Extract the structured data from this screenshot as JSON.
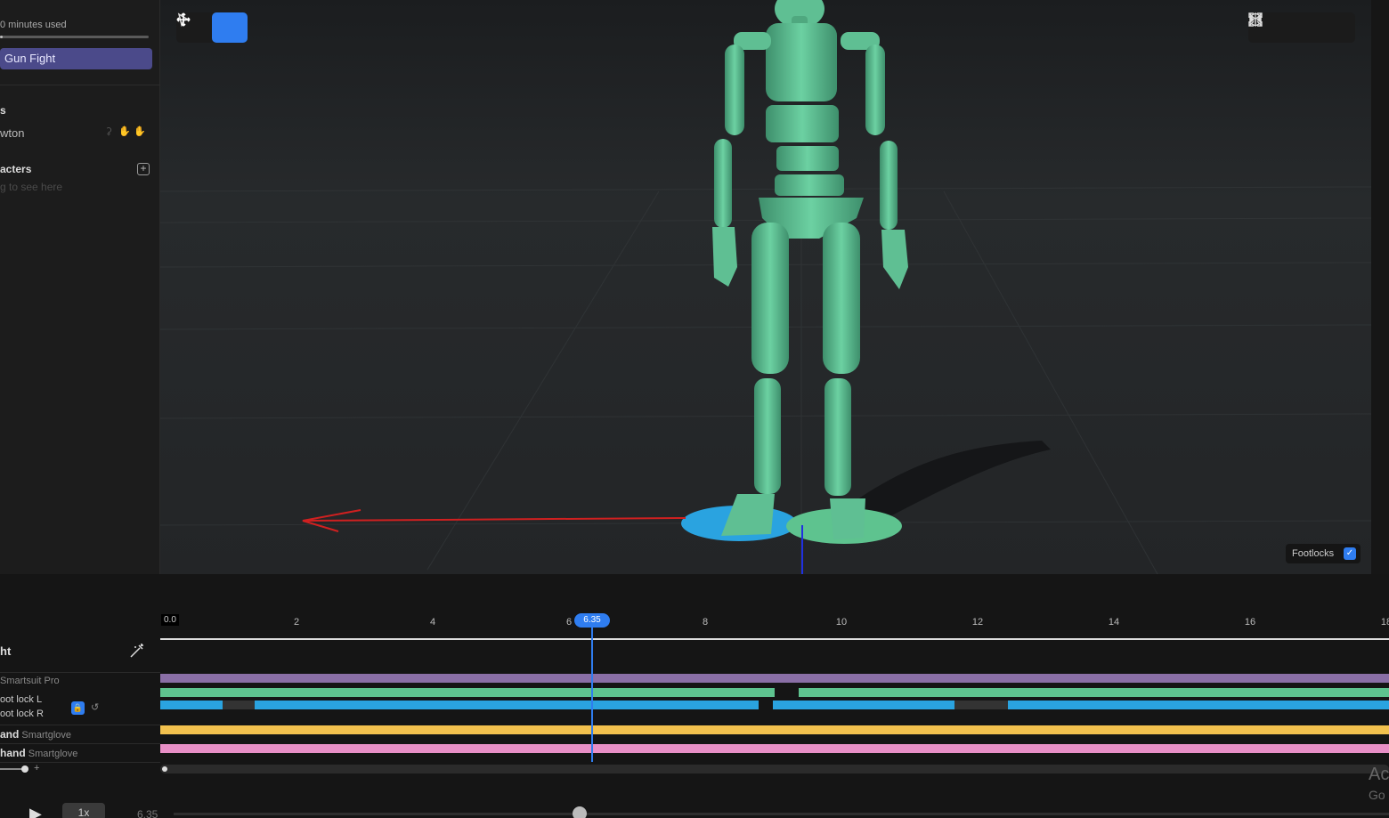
{
  "sidebar": {
    "usage_label": "0 minutes used",
    "usage_fraction": 0.02,
    "scene_name": "Gun Fight",
    "actors_heading": "s",
    "actor_name": "wton",
    "actor_icons": [
      "body-icon",
      "left-hand-icon",
      "right-hand-icon"
    ],
    "characters_heading": "acters",
    "characters_hint": "g to see here"
  },
  "viewport": {
    "tools": [
      "select-tool",
      "move-tool"
    ],
    "active_tool": "move-tool",
    "view_buttons": [
      "cube-icon",
      "mirror-icon",
      "fullscreen-icon"
    ],
    "footlocks_label": "Footlocks",
    "footlocks_checked": true,
    "colors": {
      "character": "#5fbf93",
      "left_foot": "#2aa3e0",
      "right_foot": "#5ec38f",
      "axis_x": "#e02020",
      "axis_z": "#2030e0"
    }
  },
  "timeline": {
    "ticks": [
      "2",
      "4",
      "6",
      "8",
      "10",
      "12",
      "14",
      "16",
      "18"
    ],
    "start_label": "0.0",
    "playhead_label": "6.35",
    "take_name": "ht",
    "tracks": {
      "suit_label": "Smartsuit Pro",
      "footlock_l": "oot lock L",
      "footlock_r": "oot lock R",
      "right_hand": "and",
      "right_hand_device": "Smartglove",
      "left_hand": "hand",
      "left_hand_device": "Smartglove"
    },
    "colors": {
      "suit": "#8a6fa6",
      "footlock_l": "#5ec38f",
      "footlock_r": "#2aa3e0",
      "right_hand": "#f2c14e",
      "left_hand": "#e88fc6",
      "playhead": "#2f7df0"
    }
  },
  "transport": {
    "play_icon": "play-icon",
    "speed": "1x",
    "time": "6.35"
  },
  "os_watermark": {
    "line1": "Ac",
    "line2": "Go"
  }
}
